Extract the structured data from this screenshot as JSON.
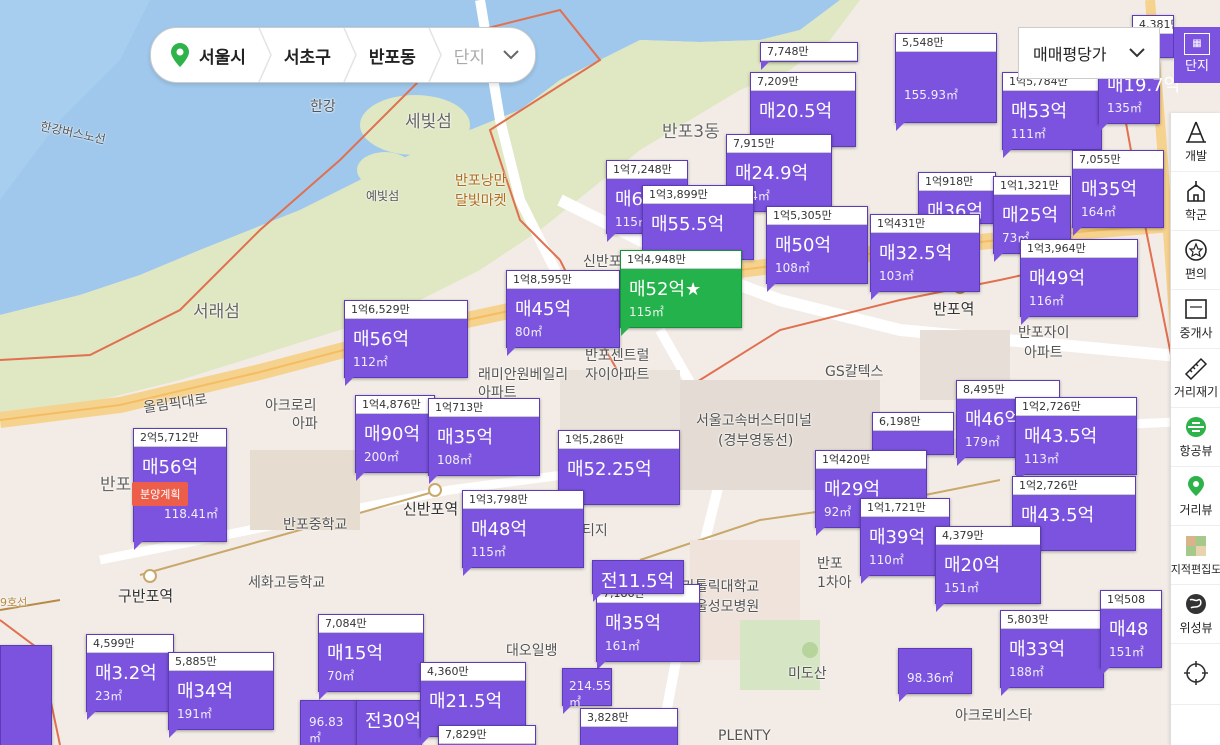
{
  "location_bar": {
    "city": "서울시",
    "district": "서초구",
    "dong": "반포동",
    "complex_placeholder": "단지"
  },
  "price_selector": {
    "value": "매매평당가"
  },
  "complex_button": {
    "label": "단지"
  },
  "sidebar": {
    "items": [
      {
        "label": "개발",
        "icon": "crane-icon"
      },
      {
        "label": "학군",
        "icon": "school-icon"
      },
      {
        "label": "편의",
        "icon": "star-circle-icon"
      },
      {
        "label": "중개사",
        "icon": "agent-icon"
      },
      {
        "label": "거리재기",
        "icon": "ruler-icon"
      },
      {
        "label": "항공뷰",
        "icon": "aerial-icon"
      },
      {
        "label": "거리뷰",
        "icon": "street-pin-icon"
      },
      {
        "label": "지적편집도",
        "icon": "cadastral-icon"
      },
      {
        "label": "위성뷰",
        "icon": "globe-icon"
      },
      {
        "label": "",
        "icon": "crosshair-icon"
      }
    ]
  },
  "places": [
    {
      "name": "한강",
      "style": "normal"
    },
    {
      "name": "세빛섬",
      "style": "big"
    },
    {
      "name": "예빛섬",
      "style": "small"
    },
    {
      "name": "한강버스노선",
      "style": "small"
    },
    {
      "name": "반포낭만",
      "style": "normal"
    },
    {
      "name": "달빛마켓",
      "style": "normal"
    },
    {
      "name": "반포3동",
      "style": "big"
    },
    {
      "name": "서래섬",
      "style": "big"
    },
    {
      "name": "올림픽대로",
      "style": "normal"
    },
    {
      "name": "아크로리",
      "style": "normal"
    },
    {
      "name": "아파",
      "style": "normal"
    },
    {
      "name": "반포",
      "style": "big"
    },
    {
      "name": "반포중학교",
      "style": "normal"
    },
    {
      "name": "세화고등학교",
      "style": "normal"
    },
    {
      "name": "구반포역",
      "style": "dark"
    },
    {
      "name": "9호선",
      "style": "small"
    },
    {
      "name": "신반포역",
      "style": "dark"
    },
    {
      "name": "신반포",
      "style": "normal"
    },
    {
      "name": "반포센트럴",
      "style": "normal"
    },
    {
      "name": "자이아파트",
      "style": "normal"
    },
    {
      "name": "래미안원베일리",
      "style": "normal"
    },
    {
      "name": "아파트",
      "style": "normal"
    },
    {
      "name": "GS칼텍스",
      "style": "normal"
    },
    {
      "name": "서울고속버스터미널",
      "style": "normal"
    },
    {
      "name": "(경부영동선)",
      "style": "normal"
    },
    {
      "name": "반포역",
      "style": "dark"
    },
    {
      "name": "반포자이",
      "style": "normal"
    },
    {
      "name": "아파트",
      "style": "normal"
    },
    {
      "name": "가톨릭대학교",
      "style": "normal"
    },
    {
      "name": "서울성모병원",
      "style": "normal"
    },
    {
      "name": "미도산",
      "style": "normal"
    },
    {
      "name": "아크로비스타",
      "style": "normal"
    },
    {
      "name": "PLENTY",
      "style": "normal"
    },
    {
      "name": "반포",
      "style": "normal"
    },
    {
      "name": "1차아",
      "style": "normal"
    },
    {
      "name": "대오일뱅",
      "style": "normal"
    },
    {
      "name": "티지",
      "style": "normal"
    }
  ],
  "markers": [
    {
      "header": "7,748만",
      "price": "매20.5억",
      "area": "",
      "variant": "normal"
    },
    {
      "header": "7,209만",
      "price": "매20.5억",
      "area": "",
      "variant": "normal"
    },
    {
      "header": "5,548만",
      "price": "",
      "area": "155.93㎡",
      "variant": "normal"
    },
    {
      "header": "1억5,784만",
      "price": "매53억",
      "area": "111㎡",
      "variant": "normal"
    },
    {
      "header": "",
      "price": "매19.7억",
      "area": "135㎡",
      "variant": "normal"
    },
    {
      "header": "7,915만",
      "price": "매24.9억",
      "area": "104㎡",
      "variant": "normal"
    },
    {
      "header": "1억7,248만",
      "price": "매6",
      "area": "115㎡",
      "variant": "normal"
    },
    {
      "header": "1억3,899만",
      "price": "매55.5억",
      "area": "",
      "variant": "normal"
    },
    {
      "header": "1억5,305만",
      "price": "매50억",
      "area": "108㎡",
      "variant": "normal"
    },
    {
      "header": "1억918만",
      "price": "매36억",
      "area": "",
      "variant": "normal"
    },
    {
      "header": "1억1,321만",
      "price": "매25억",
      "area": "73㎡",
      "variant": "normal"
    },
    {
      "header": "7,055만",
      "price": "매35억",
      "area": "164㎡",
      "variant": "normal"
    },
    {
      "header": "1억431만",
      "price": "매32.5억",
      "area": "103㎡",
      "variant": "normal"
    },
    {
      "header": "1억3,964만",
      "price": "매49억",
      "area": "116㎡",
      "variant": "normal"
    },
    {
      "header": "1억8,595만",
      "price": "매45억",
      "area": "80㎡",
      "variant": "normal"
    },
    {
      "header": "1억4,948만",
      "price": "매52억★",
      "area": "115㎡",
      "variant": "selected"
    },
    {
      "header": "1억6,529만",
      "price": "매56억",
      "area": "112㎡",
      "variant": "normal"
    },
    {
      "header": "1억4,876만",
      "price": "매90억",
      "area": "200㎡",
      "variant": "normal"
    },
    {
      "header": "1억713만",
      "price": "매35억",
      "area": "108㎡",
      "variant": "normal"
    },
    {
      "header": "2억5,712만",
      "price": "매56억",
      "area": "118.41㎡",
      "variant": "normal"
    },
    {
      "header": "1억5,286만",
      "price": "매52.25억",
      "area": "",
      "variant": "normal"
    },
    {
      "header": "8,495만",
      "price": "매46억",
      "area": "179㎡",
      "variant": "normal"
    },
    {
      "header": "1억2,726만",
      "price": "매43.5억",
      "area": "113㎡",
      "variant": "normal"
    },
    {
      "header": "6,198만",
      "price": "",
      "area": "",
      "variant": "normal"
    },
    {
      "header": "1억420만",
      "price": "매29억",
      "area": "92㎡",
      "variant": "normal"
    },
    {
      "header": "1억2,726만",
      "price": "매43.5억",
      "area": "",
      "variant": "normal"
    },
    {
      "header": "1억3,798만",
      "price": "매48억",
      "area": "115㎡",
      "variant": "normal"
    },
    {
      "header": "1억1,721만",
      "price": "매39억",
      "area": "110㎡",
      "variant": "normal"
    },
    {
      "header": "4,379만",
      "price": "매20억",
      "area": "151㎡",
      "variant": "normal"
    },
    {
      "header": "7,186만",
      "price": "매35억",
      "area": "161㎡",
      "variant": "normal"
    },
    {
      "header": "7,084만",
      "price": "매15억",
      "area": "70㎡",
      "variant": "normal"
    },
    {
      "header": "5,803만",
      "price": "매33억",
      "area": "188㎡",
      "variant": "normal"
    },
    {
      "header": "4,599만",
      "price": "매3.2억",
      "area": "23㎡",
      "variant": "normal"
    },
    {
      "header": "5,885만",
      "price": "매34억",
      "area": "191㎡",
      "variant": "normal"
    },
    {
      "header": "4,360만",
      "price": "매21.5억",
      "area": "",
      "variant": "normal"
    },
    {
      "header": "3,828만",
      "price": "",
      "area": "",
      "variant": "normal"
    },
    {
      "header": "7,829만",
      "price": "",
      "area": "",
      "variant": "normal"
    },
    {
      "header": "",
      "price": "전30억",
      "area": "",
      "variant": "normal"
    },
    {
      "header": "",
      "price": "",
      "area": "96.83㎡",
      "variant": "normal"
    },
    {
      "header": "",
      "price": "",
      "area": "214.55㎡",
      "variant": "normal"
    },
    {
      "header": "",
      "price": "",
      "area": "98.36㎡",
      "variant": "normal"
    },
    {
      "header": "1억508",
      "price": "매48",
      "area": "151㎡",
      "variant": "normal"
    },
    {
      "header": "4,381만",
      "price": "",
      "area": "",
      "variant": "normal"
    },
    {
      "header": "",
      "price": "전11.5억",
      "area": "",
      "variant": "normal"
    }
  ],
  "badge": {
    "label": "분양계획"
  }
}
